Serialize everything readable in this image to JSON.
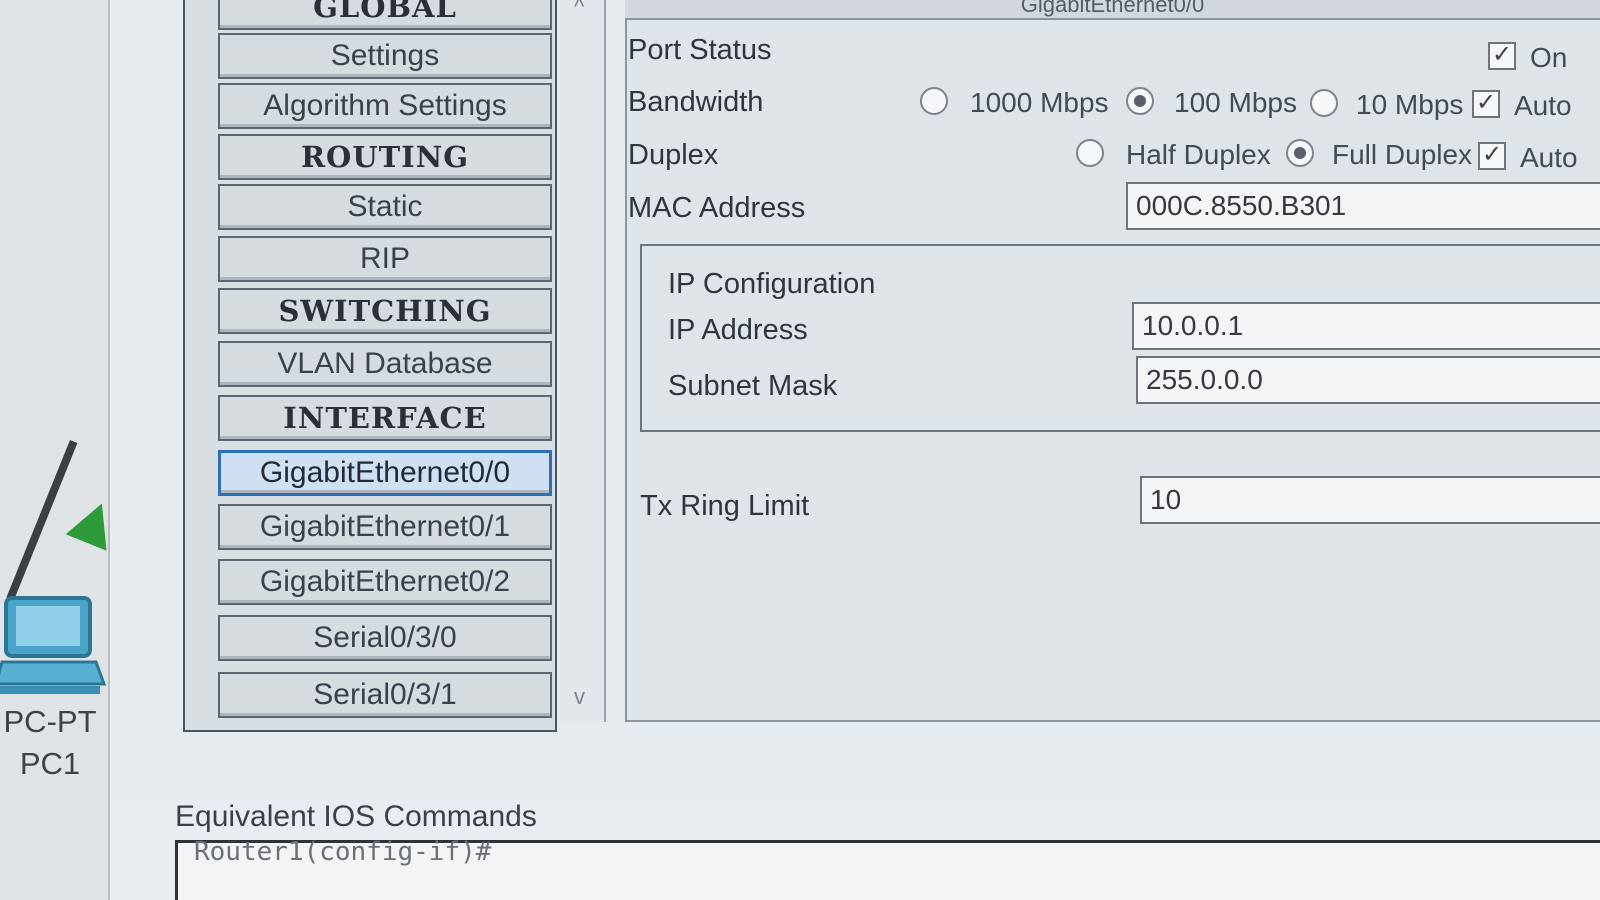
{
  "panel": {
    "title": "GigabitEthernet0/0"
  },
  "device": {
    "type_label": "PC-PT",
    "name_label": "PC1"
  },
  "menu": {
    "items": [
      {
        "label": "GLOBAL",
        "kind": "header"
      },
      {
        "label": "Settings",
        "kind": "item"
      },
      {
        "label": "Algorithm Settings",
        "kind": "item"
      },
      {
        "label": "ROUTING",
        "kind": "header"
      },
      {
        "label": "Static",
        "kind": "item"
      },
      {
        "label": "RIP",
        "kind": "item"
      },
      {
        "label": "SWITCHING",
        "kind": "header"
      },
      {
        "label": "VLAN Database",
        "kind": "item"
      },
      {
        "label": "INTERFACE",
        "kind": "header"
      },
      {
        "label": "GigabitEthernet0/0",
        "kind": "item",
        "selected": true
      },
      {
        "label": "GigabitEthernet0/1",
        "kind": "item"
      },
      {
        "label": "GigabitEthernet0/2",
        "kind": "item"
      },
      {
        "label": "Serial0/3/0",
        "kind": "item"
      },
      {
        "label": "Serial0/3/1",
        "kind": "item"
      }
    ]
  },
  "port_status": {
    "label": "Port Status",
    "on_label": "On",
    "on_checked": true
  },
  "bandwidth": {
    "label": "Bandwidth",
    "options": [
      "1000 Mbps",
      "100 Mbps",
      "10 Mbps"
    ],
    "selected": "100 Mbps",
    "auto_label": "Auto",
    "auto_checked": true
  },
  "duplex": {
    "label": "Duplex",
    "options": [
      "Half Duplex",
      "Full Duplex"
    ],
    "selected": "Full Duplex",
    "auto_label": "Auto",
    "auto_checked": true
  },
  "mac": {
    "label": "MAC Address",
    "value": "000C.8550.B301"
  },
  "ip_config": {
    "title": "IP Configuration",
    "ip_label": "IP Address",
    "ip_value": "10.0.0.1",
    "mask_label": "Subnet Mask",
    "mask_value": "255.0.0.0"
  },
  "tx_ring": {
    "label": "Tx Ring Limit",
    "value": "10"
  },
  "ios": {
    "label": "Equivalent IOS Commands",
    "console_text": "Router1(config-if)#"
  },
  "icons": {
    "check": "✓",
    "scroll_up": "^",
    "scroll_down": "v"
  },
  "colors": {
    "selected_border": "#2f6fb6",
    "link_green": "#2e9b3a",
    "pc_blue": "#4aa3c8"
  }
}
